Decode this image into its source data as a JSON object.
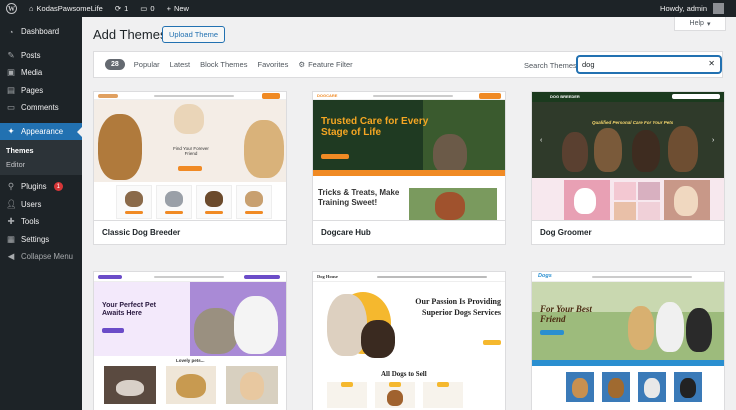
{
  "adminbar": {
    "site_name": "KodasPawsomeLife",
    "updates_count": "1",
    "comments_count": "0",
    "new_label": "New",
    "howdy": "Howdy, admin"
  },
  "sidebar": {
    "items": [
      {
        "label": "Dashboard",
        "icon": "dashboard-icon"
      },
      {
        "label": "Posts",
        "icon": "pin-icon"
      },
      {
        "label": "Media",
        "icon": "media-icon"
      },
      {
        "label": "Pages",
        "icon": "pages-icon"
      },
      {
        "label": "Comments",
        "icon": "comments-icon"
      },
      {
        "label": "Appearance",
        "icon": "appearance-icon"
      },
      {
        "label": "Plugins",
        "icon": "plugins-icon",
        "badge": "1"
      },
      {
        "label": "Users",
        "icon": "users-icon"
      },
      {
        "label": "Tools",
        "icon": "tools-icon"
      },
      {
        "label": "Settings",
        "icon": "settings-icon"
      },
      {
        "label": "Collapse Menu",
        "icon": "collapse-icon"
      }
    ],
    "appearance_sub": [
      "Themes",
      "Editor"
    ]
  },
  "header": {
    "help_label": "Help",
    "title": "Add Themes",
    "upload_label": "Upload Theme"
  },
  "filters": {
    "count": "28",
    "links": [
      "Popular",
      "Latest",
      "Block Themes",
      "Favorites"
    ],
    "feature_filter": "Feature Filter",
    "search_label": "Search Themes",
    "search_value": "dog"
  },
  "themes": [
    {
      "name": "Classic Dog Breeder",
      "shot": {
        "title": "Find Your Forever Friend"
      }
    },
    {
      "name": "Dogcare Hub",
      "shot": {
        "logo": "DOGCARE",
        "title": "Trusted Care for Every Stage of Life",
        "sub": "Tricks & Treats, Make Training Sweet!"
      }
    },
    {
      "name": "Dog Groomer",
      "shot": {
        "logo": "DOG BREEDER",
        "title": "Qualified Personal Care For Your Pets"
      }
    },
    {
      "name": "",
      "shot": {
        "title": "Your Perfect Pet Awaits Here",
        "sub": "Lovely pets..."
      }
    },
    {
      "name": "",
      "shot": {
        "logo": "Dog House",
        "title": "Our Passion Is Providing Superior Dogs Services",
        "sub": "All Dogs to Sell"
      }
    },
    {
      "name": "",
      "shot": {
        "logo": "Dogs",
        "title": "For Your Best Friend"
      }
    }
  ],
  "colors": {
    "accent": "#2271b1",
    "adminbar": "#1d2327",
    "badge": "#d63638"
  }
}
